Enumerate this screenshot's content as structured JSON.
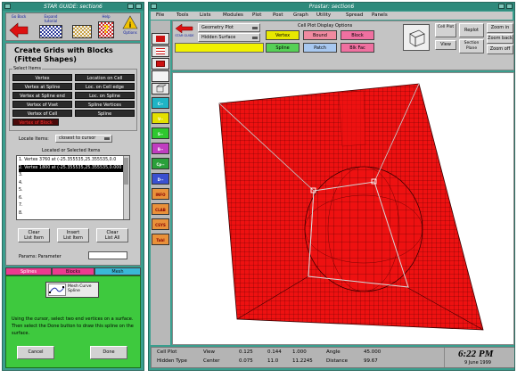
{
  "left_window": {
    "title": "STAR GUIDE: section6",
    "toolbar": {
      "go_back": "Go Back",
      "expand_line1": "Expand",
      "expand_line2": "tutorial",
      "help": "Help",
      "options": "Options"
    },
    "heading_line1": "Create Grids with Blocks",
    "heading_line2": "(Fitted Shapes)",
    "select_items_label": "Select Items",
    "items": [
      {
        "label": "Vertex",
        "selected": false
      },
      {
        "label": "Location on Cell",
        "selected": false
      },
      {
        "label": "Vertex at Spline",
        "selected": false
      },
      {
        "label": "Loc. on Cell edge",
        "selected": false
      },
      {
        "label": "Vertex at Spline end",
        "selected": false
      },
      {
        "label": "Loc. on Spline",
        "selected": false
      },
      {
        "label": "Vertex of Vset",
        "selected": false
      },
      {
        "label": "Spline Vertices",
        "selected": false
      },
      {
        "label": "Vertex of Cell",
        "selected": false
      },
      {
        "label": "Spline",
        "selected": false
      },
      {
        "label": "Vertex of Block",
        "selected": true
      }
    ],
    "locate_items_label": "Locate Items:",
    "locate_dropdown": "closest to cursor",
    "located_label": "Located or Selected Items",
    "located_items": [
      "1. Vertex 3760 at (-25.355535,25.355535,0.0",
      "2. Vertex 1800 at (-25.355535,25.355535,0.000",
      "3.",
      "4.",
      "5.",
      "6.",
      "7.",
      "8."
    ],
    "clear_list_line1": "Clear",
    "clear_list_line2": "List Item",
    "insert_list_line1": "Insert",
    "insert_list_line2": "List Item",
    "clear_all_line1": "Clear",
    "clear_all_line2": "List All",
    "parameter_label": "Params: Parameter",
    "tabs": [
      "Splines",
      "Blocks",
      "Mesh"
    ],
    "spline_icon_label": "Mesh Curve Spline",
    "instructions": "Using the cursor, select two end vertices on a surface. Then select the Done button to draw this spline on the surface.",
    "cancel_label": "Cancel",
    "done_label": "Done"
  },
  "right_window": {
    "title": "Prostar: section6",
    "menu": [
      "File",
      "Tools",
      "Lists",
      "Modules",
      "Plot",
      "Post",
      "Graph",
      "Utility",
      "Spread",
      "Panels"
    ],
    "side_palette": [
      "C--",
      "V--",
      "S--",
      "B--",
      "Cp--",
      "D--",
      "INFO",
      "CLAB",
      "CSYS",
      "Tabl"
    ],
    "side_palette_colors": [
      "#1fb5c5",
      "#e4e000",
      "#2fc82f",
      "#c03dc0",
      "#2aa03a",
      "#3a50d0",
      "#e9913a",
      "#e9913a",
      "#e9913a",
      "#e9913a"
    ],
    "star_logo": "STAR GUIDE",
    "geometry_plot": "Geometry Plot",
    "hidden_surface": "Hidden Surface",
    "cell_plot_options_label": "Cell Plot Display Options",
    "display_buttons": [
      {
        "label": "Vertex",
        "color": "#e8e800"
      },
      {
        "label": "Bound",
        "color": "#f08aa0"
      },
      {
        "label": "Block",
        "color": "#f070a0"
      },
      {
        "label": "Spline",
        "color": "#56d056"
      },
      {
        "label": "Patch",
        "color": "#a8c8f0"
      },
      {
        "label": "Blk Fac",
        "color": "#f070a0"
      }
    ],
    "cell_plot_btn": "Cell Plot",
    "view_btn": "View",
    "replot": "Replot",
    "section_plane": "Section Plane",
    "zoom_in": "Zoom in",
    "zoom_back": "Zoom back",
    "zoom_off": "Zoom off",
    "mesh_color": "#ee1111",
    "status": {
      "row1": [
        "Cell Plot",
        "View",
        "0.125",
        "0.144",
        "1.000",
        "Angle",
        "45.000"
      ],
      "row2": [
        "Hidden Type",
        "Center",
        "0.075",
        "11.0",
        "11.2245",
        "Distance",
        "99.67"
      ],
      "time": "6:22 PM",
      "date": "9 June 1999"
    }
  }
}
